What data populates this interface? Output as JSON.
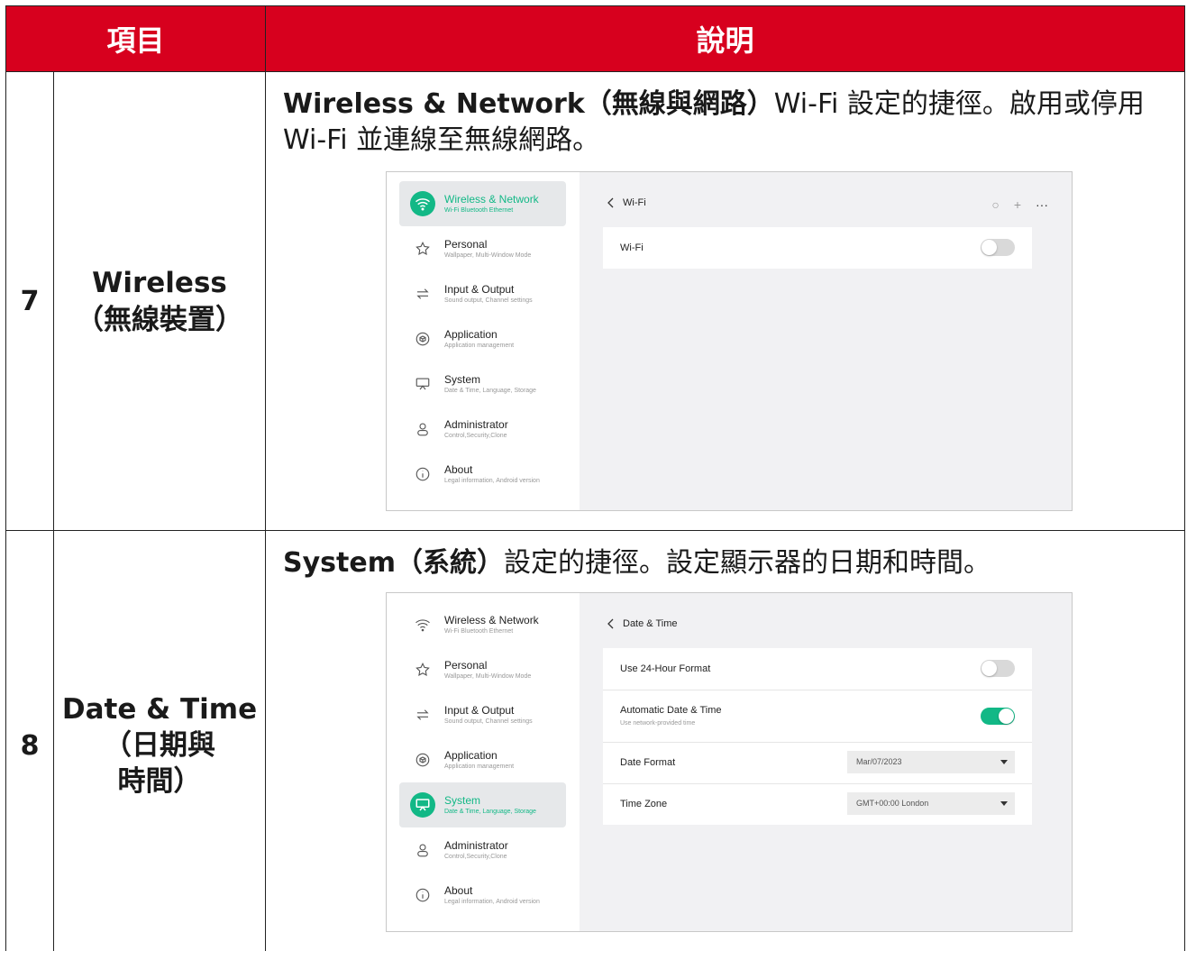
{
  "header": {
    "col_item": "項目",
    "col_desc": "說明"
  },
  "rows": [
    {
      "number": "7",
      "item_line1": "Wireless",
      "item_line2": "（無線裝置）",
      "desc_bold": "Wireless & Network（無線與網路）",
      "desc_rest": "Wi-Fi 設定的捷徑。啟用或停用 Wi-Fi 並連線至無線網路。",
      "screen": {
        "panel_title": "Wi-Fi",
        "settings": [
          {
            "label": "Wi-Fi",
            "toggle": "off"
          }
        ]
      }
    },
    {
      "number": "8",
      "item_line1": "Date & Time",
      "item_line2": "（日期與",
      "item_line3": "時間）",
      "desc_bold": "System（系統）",
      "desc_rest": "設定的捷徑。設定顯示器的日期和時間。",
      "screen": {
        "panel_title": "Date & Time",
        "settings": [
          {
            "label": "Use 24-Hour Format",
            "toggle": "off"
          },
          {
            "label": "Automatic Date & Time",
            "sub": "Use network-provided time",
            "toggle": "on"
          },
          {
            "label": "Date Format",
            "value": "Mar/07/2023"
          },
          {
            "label": "Time Zone",
            "value": "GMT+00:00 London"
          }
        ]
      }
    }
  ],
  "sidebar": [
    {
      "title": "Wireless & Network",
      "sub": "Wi-Fi Bluetooth Ethernet",
      "icon": "wifi-icon"
    },
    {
      "title": "Personal",
      "sub": "Wallpaper, Multi-Window Mode",
      "icon": "star-icon"
    },
    {
      "title": "Input & Output",
      "sub": "Sound output, Channel settings",
      "icon": "swap-icon"
    },
    {
      "title": "Application",
      "sub": "Application management",
      "icon": "cube-icon"
    },
    {
      "title": "System",
      "sub": "Date & Time, Language, Storage",
      "icon": "monitor-icon"
    },
    {
      "title": "Administrator",
      "sub": "Control,Security,Clone",
      "icon": "user-icon"
    },
    {
      "title": "About",
      "sub": "Legal information, Android version",
      "icon": "info-icon"
    }
  ],
  "colors": {
    "header_bg": "#d7001e",
    "accent": "#12b886"
  }
}
